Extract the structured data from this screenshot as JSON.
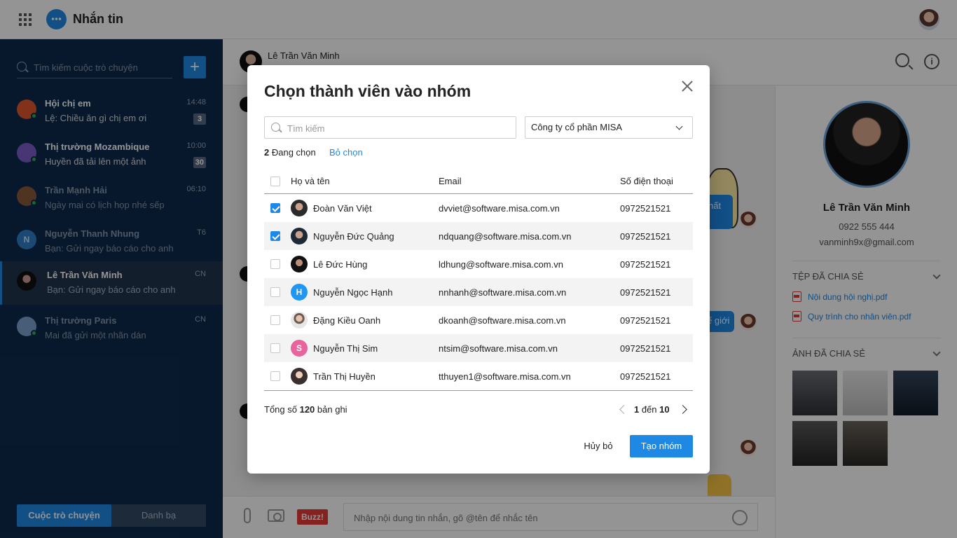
{
  "app": {
    "title": "Nhắn tin"
  },
  "sidebar": {
    "search_placeholder": "Tìm kiếm cuộc trò chuyện",
    "conversations": [
      {
        "name": "Hội chị em",
        "message": "Lệ: Chiều ăn gì chị em ơi",
        "time": "14:48",
        "badge": "3",
        "avatar_color": "#e0562b"
      },
      {
        "name": "Thị trường Mozambique",
        "message": "Huyền đã tải lên một ảnh",
        "time": "10:00",
        "badge": "30",
        "avatar_color": "#7c5cc9"
      },
      {
        "name": "Trần Mạnh Hải",
        "message": "Ngày mai có lịch họp nhé sếp",
        "time": "06:10",
        "badge": "",
        "avatar_color": "#8a5a3c"
      },
      {
        "name": "Nguyễn Thanh Nhung",
        "message": "Bạn: Gửi ngay báo cáo cho anh",
        "time": "T6",
        "badge": "",
        "avatar_color": "#2d80c9",
        "initial": "N"
      },
      {
        "name": "Lê Trần Văn Minh",
        "message": "Bạn: Gửi ngay báo cáo cho anh",
        "time": "CN",
        "badge": "",
        "avatar_color": "#111111"
      },
      {
        "name": "Thị trường Paris",
        "message": "Mai đã gửi một nhãn dán",
        "time": "CN",
        "badge": "",
        "avatar_color": "#7da3cf"
      }
    ],
    "tabs": {
      "chats": "Cuộc trò chuyện",
      "contacts": "Danh bạ"
    }
  },
  "chat": {
    "header_name": "Lê Trần Văn Minh",
    "bubble_1": "hất",
    "bubble_2": "ế giới",
    "compose_placeholder": "Nhập nội dung tin nhắn, gõ @tên để nhắc tên",
    "buzz_label": "Buzz!"
  },
  "info": {
    "name": "Lê Trần Văn Minh",
    "phone": "0922 555 444",
    "email": "vanminh9x@gmail.com",
    "files_title": "TỆP ĐÃ CHIA SẺ",
    "files": [
      "Nội dung hội nghị.pdf",
      "Quy trình cho nhân viên.pdf"
    ],
    "photos_title": "ẢNH ĐÃ CHIA SẺ",
    "photo_colors": [
      "#3a3f45",
      "#cfcfcf",
      "#1e2a38",
      "#3b3b3b",
      "#4b4640"
    ]
  },
  "modal": {
    "title": "Chọn thành viên vào nhóm",
    "search_placeholder": "Tìm kiếm",
    "company": "Công ty cổ phần MISA",
    "selected_count": "2",
    "selected_label": " Đang chọn",
    "unselect": "Bỏ chọn",
    "columns": {
      "name": "Họ và tên",
      "email": "Email",
      "phone": "Số điện thoại"
    },
    "rows": [
      {
        "name": "Đoàn Văn Việt",
        "email": "dvviet@software.misa.com.vn",
        "phone": "0972521521",
        "checked": true,
        "avatar_color": "#2b2b2b",
        "initial": ""
      },
      {
        "name": "Nguyễn Đức Quảng",
        "email": "ndquang@software.misa.com.vn",
        "phone": "0972521521",
        "checked": true,
        "avatar_color": "#1e2a38",
        "initial": ""
      },
      {
        "name": "Lê Đức Hùng",
        "email": "ldhung@software.misa.com.vn",
        "phone": "0972521521",
        "checked": false,
        "avatar_color": "#111111",
        "initial": ""
      },
      {
        "name": "Nguyễn Ngọc Hạnh",
        "email": "nnhanh@software.misa.com.vn",
        "phone": "0972521521",
        "checked": false,
        "avatar_color": "#2196f3",
        "initial": "H"
      },
      {
        "name": "Đặng Kiều Oanh",
        "email": "dkoanh@software.misa.com.vn",
        "phone": "0972521521",
        "checked": false,
        "avatar_color": "#d8d8d8",
        "initial": ""
      },
      {
        "name": "Nguyễn Thị Sim",
        "email": "ntsim@software.misa.com.vn",
        "phone": "0972521521",
        "checked": false,
        "avatar_color": "#e8649c",
        "initial": "S"
      },
      {
        "name": "Trần Thị Huyền",
        "email": "tthuyen1@software.misa.com.vn",
        "phone": "0972521521",
        "checked": false,
        "avatar_color": "#3a3030",
        "initial": ""
      }
    ],
    "total_prefix": "Tổng số ",
    "total_count": "120",
    "total_suffix": " bản ghi",
    "page_from": "1",
    "page_sep": " đến ",
    "page_to": "10",
    "cancel": "Hủy bỏ",
    "create": "Tạo nhóm"
  }
}
